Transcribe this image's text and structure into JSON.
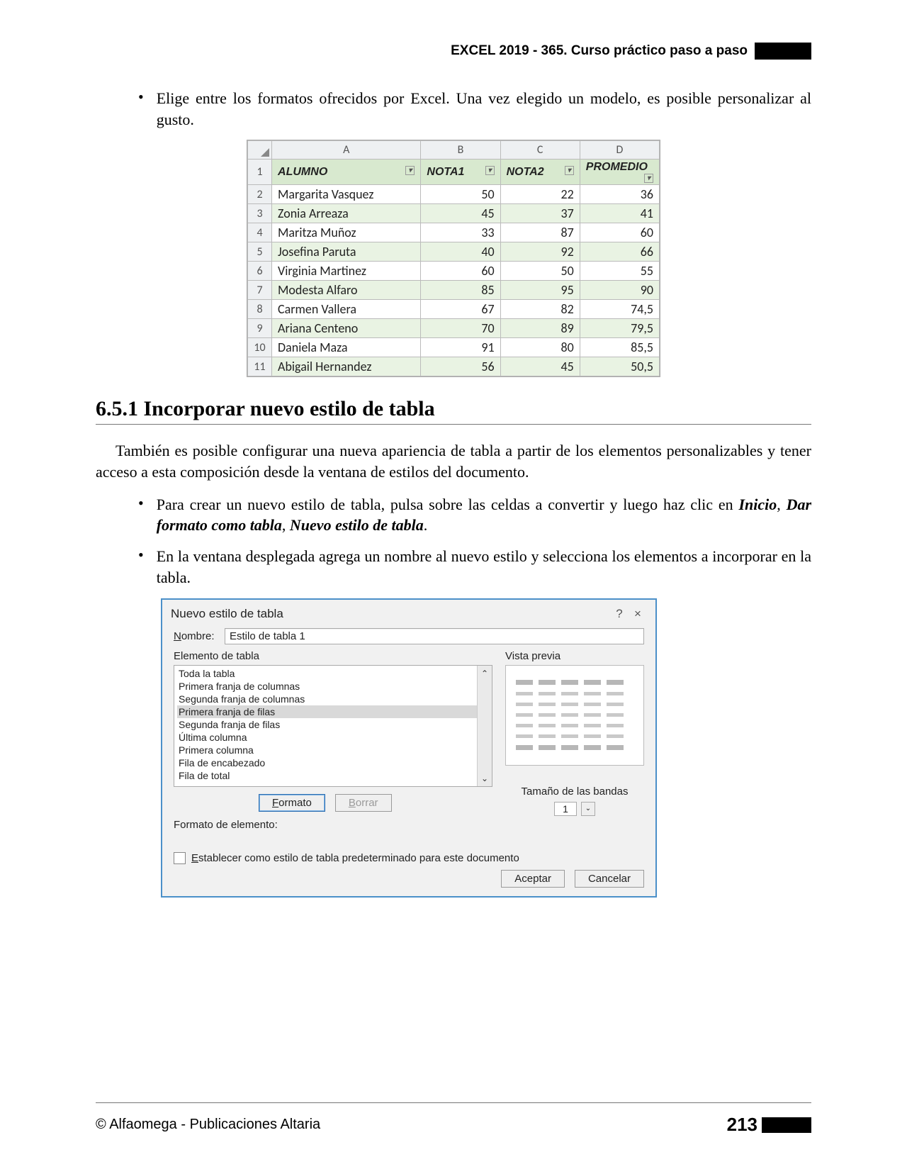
{
  "header": {
    "title": "EXCEL 2019 - 365. Curso práctico paso a paso"
  },
  "intro_bullet": "Elige entre los formatos ofrecidos por Excel. Una vez elegido un modelo, es posible personalizar al gusto.",
  "excel_figure": {
    "columns": [
      "A",
      "B",
      "C",
      "D"
    ],
    "headers": [
      "ALUMNO",
      "NOTA1",
      "NOTA2",
      "PROMEDIO"
    ],
    "rows": [
      {
        "n": "1"
      },
      {
        "n": "2",
        "name": "Margarita Vasquez",
        "v": [
          "50",
          "22",
          "36"
        ]
      },
      {
        "n": "3",
        "name": "Zonia Arreaza",
        "v": [
          "45",
          "37",
          "41"
        ]
      },
      {
        "n": "4",
        "name": "Maritza Muñoz",
        "v": [
          "33",
          "87",
          "60"
        ]
      },
      {
        "n": "5",
        "name": "Josefina Paruta",
        "v": [
          "40",
          "92",
          "66"
        ]
      },
      {
        "n": "6",
        "name": "Virginia Martinez",
        "v": [
          "60",
          "50",
          "55"
        ]
      },
      {
        "n": "7",
        "name": "Modesta Alfaro",
        "v": [
          "85",
          "95",
          "90"
        ]
      },
      {
        "n": "8",
        "name": "Carmen Vallera",
        "v": [
          "67",
          "82",
          "74,5"
        ]
      },
      {
        "n": "9",
        "name": "Ariana Centeno",
        "v": [
          "70",
          "89",
          "79,5"
        ]
      },
      {
        "n": "10",
        "name": "Daniela Maza",
        "v": [
          "91",
          "80",
          "85,5"
        ]
      },
      {
        "n": "11",
        "name": "Abigail Hernandez",
        "v": [
          "56",
          "45",
          "50,5"
        ]
      }
    ]
  },
  "section_heading": "6.5.1 Incorporar nuevo estilo de tabla",
  "paragraph": "También es posible configurar una nueva apariencia de tabla a partir de los elementos personalizables y tener acceso a esta composición desde la ventana de estilos del documento.",
  "bullets": [
    {
      "pre": "Para crear un nuevo estilo de tabla, pulsa sobre las celdas a convertir y luego haz clic en ",
      "b1": "Inicio",
      "s1": ", ",
      "b2": "Dar formato como tabla",
      "s2": ", ",
      "b3": "Nuevo estilo de tabla",
      "post": "."
    },
    {
      "text": "En la ventana desplegada agrega un nombre al nuevo estilo y selecciona los elementos a incorporar en la tabla."
    }
  ],
  "dialog": {
    "title": "Nuevo estilo de tabla",
    "name_label_u": "N",
    "name_label_rest": "ombre:",
    "name_value": "Estilo de tabla 1",
    "element_label_u": "E",
    "element_label_rest": "lemento de tabla",
    "preview_label": "Vista previa",
    "items": [
      "Toda la tabla",
      "Primera franja de columnas",
      "Segunda franja de columnas",
      "Primera franja de filas",
      "Segunda franja de filas",
      "Última columna",
      "Primera columna",
      "Fila de encabezado",
      "Fila de total"
    ],
    "selected_index": 3,
    "bands_label": "Tamaño de las bandas",
    "bands_value": "1",
    "format_btn_u": "F",
    "format_btn_rest": "ormato",
    "clear_btn_u": "B",
    "clear_btn_rest": "orrar",
    "element_format_label": "Formato de elemento:",
    "checkbox_u": "E",
    "checkbox_rest": "stablecer como estilo de tabla predeterminado para este documento",
    "ok": "Aceptar",
    "cancel": "Cancelar"
  },
  "footer": {
    "left": "© Alfaomega - Publicaciones Altaria",
    "page": "213"
  }
}
